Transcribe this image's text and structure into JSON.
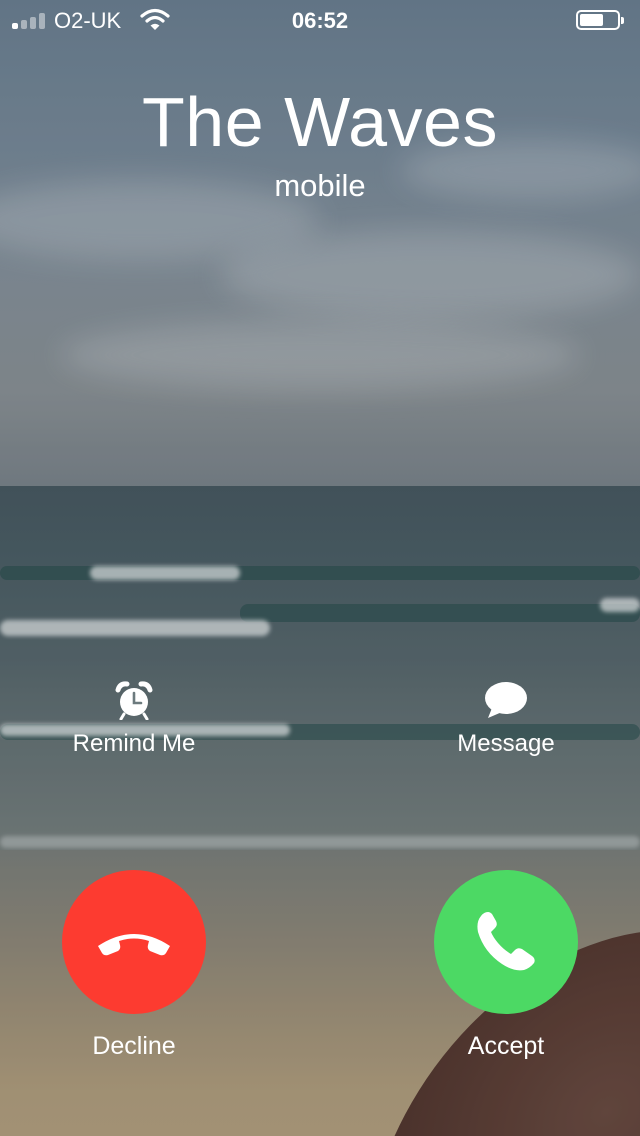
{
  "status_bar": {
    "carrier": "O2-UK",
    "time": "06:52",
    "signal_bars_filled": 1,
    "signal_bars_total": 4,
    "battery_level": 0.65
  },
  "caller": {
    "name": "The Waves",
    "label": "mobile"
  },
  "actions": {
    "remind": {
      "label": "Remind Me",
      "icon": "alarm-clock-icon"
    },
    "message": {
      "label": "Message",
      "icon": "speech-bubble-icon"
    }
  },
  "buttons": {
    "decline": {
      "label": "Decline",
      "icon": "phone-hangup-icon",
      "color": "#fd3b30"
    },
    "accept": {
      "label": "Accept",
      "icon": "phone-icon",
      "color": "#4cd964"
    }
  }
}
